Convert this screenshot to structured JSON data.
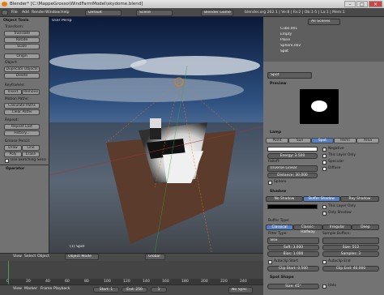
{
  "window": {
    "title": "Blender* [C:\\MappeGrosso\\WindFarmModel\\skydome.blend]"
  },
  "menu": {
    "items": [
      "File",
      "Add",
      "Render",
      "Window",
      "Help"
    ],
    "layout": "Default",
    "scene": "Scene",
    "engine": "Blender Game",
    "stats": "blender.org 262.1 | Ve:8 | Fa:2 | Ob:1-5 | La:1 | Mem:1"
  },
  "toolshelf": {
    "header": "Object Tools",
    "transform": "Transform:",
    "translate": "Translate",
    "rotate": "Rotate",
    "scale": "Scale",
    "origin": "Origin",
    "object": "Object:",
    "dup_objects": "Duplicate Objects",
    "delete": "Delete",
    "keyframes": "Keyframes:",
    "insert": "Insert",
    "remove": "Remove",
    "motion_paths": "Motion Paths:",
    "calc_paths": "Calculate Paths",
    "clear_paths": "Clear Paths",
    "repeat": "Repeat:",
    "repeat_last": "Repeat Last",
    "history": "History...",
    "grease_pencil": "Grease Pencil:",
    "draw": "Draw",
    "line": "Line",
    "poly": "Poly",
    "erase": "Erase",
    "use_sketching": "Use Sketching Sessi",
    "operator": "Operator"
  },
  "viewport": {
    "label": "User Persp",
    "object_label": "(1) Spot",
    "mode": "Object Mode",
    "pivot": "Global",
    "menu": [
      "View",
      "Select",
      "Object"
    ]
  },
  "timeline": {
    "menu": [
      "View",
      "Marker",
      "Frame",
      "Playback"
    ],
    "start": "Start: 1",
    "end": "End: 250",
    "current": "1",
    "sync": "No Sync",
    "ticks": [
      "0",
      "20",
      "40",
      "60",
      "80",
      "100",
      "120",
      "140",
      "160",
      "180",
      "200",
      "220",
      "240"
    ]
  },
  "outliner": {
    "search": "All Scenes",
    "items": [
      "Cube.001",
      "Empty",
      "Plane",
      "Sphere.002",
      "Spot"
    ]
  },
  "properties": {
    "object_name": "Spot",
    "preview": "Preview",
    "lamp": "Lamp",
    "lamp_types": [
      "Point",
      "Sun",
      "Spot",
      "Hemi",
      "Area"
    ],
    "energy": "Energy: 3.500",
    "falloff": "Falloff:",
    "falloff_value": "Inverse Linear",
    "distance": "Distance: 30.000",
    "negative": "Negative",
    "this_layer": "This Layer Only",
    "specular": "Specular",
    "diffuse": "Diffuse",
    "sphere": "Sphere",
    "shadow": "Shadow",
    "shadow_types": [
      "No Shadow",
      "Buffer Shadow",
      "Ray Shadow"
    ],
    "shadow_this_layer": "This Layer Only",
    "only_shadow": "Only Shadow",
    "buffer_type": "Buffer Type:",
    "buffer_types": [
      "Classical",
      "Classic-Halfway",
      "Irregular",
      "Deep"
    ],
    "filter_type": "Filter Type:",
    "filter_value": "Box",
    "sample_buffers": "Sample Buffers:",
    "soft": "Soft: 3.000",
    "size": "Size: 512",
    "bias": "Bias: 1.000",
    "samples": "Samples: 3",
    "autoclip_start": "Autoclip Start",
    "autoclip_end": "Autoclip End",
    "clip_start": "Clip Start: 0.500",
    "clip_end": "Clip End: 40.000",
    "spot_shape": "Spot Shape",
    "spot_size": "Size: 45°",
    "halo": "Halo"
  }
}
